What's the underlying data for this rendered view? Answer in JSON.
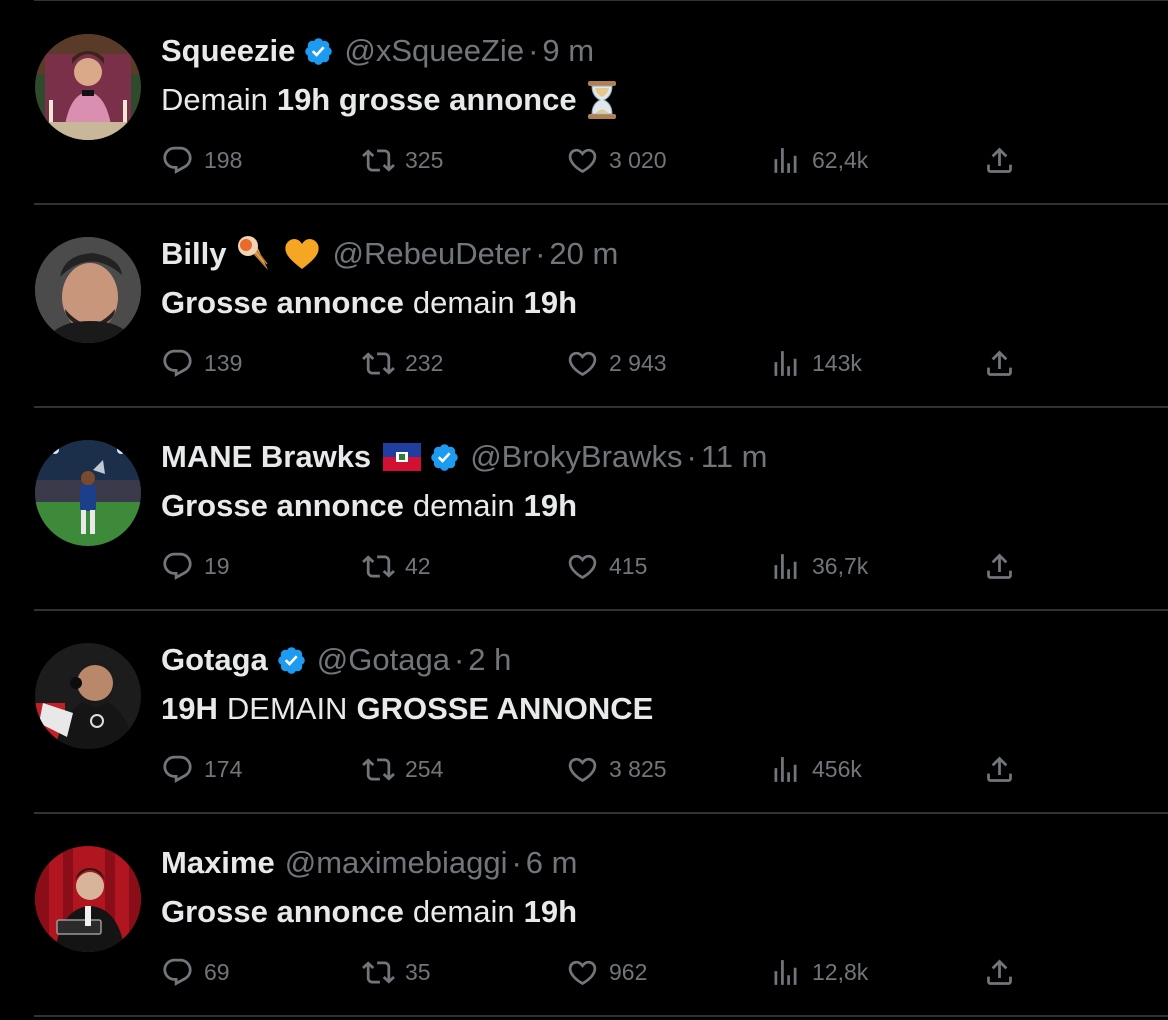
{
  "colors": {
    "background": "#000000",
    "text_primary": "#e7e9ea",
    "text_secondary": "#71767b",
    "divider": "#2f3336",
    "verified_blue": "#1d9bf0"
  },
  "tweets": [
    {
      "name": "Squeezie",
      "verified": true,
      "handle": "@xSqueeZie",
      "separator": "·",
      "time": "9 m",
      "text_parts": [
        "Demain",
        "19h grosse annonce"
      ],
      "emoji": "hourglass-emoji",
      "replies": "198",
      "retweets": "325",
      "likes": "3 020",
      "views": "62,4k"
    },
    {
      "name": "Billy",
      "verified": false,
      "handle": "@RebeuDeter",
      "separator": "·",
      "time": "20 m",
      "text_parts": [
        "Grosse annonce",
        "demain",
        "19h"
      ],
      "name_emojis": [
        "ice-cream-cone-emoji",
        "orange-heart-emoji"
      ],
      "replies": "139",
      "retweets": "232",
      "likes": "2 943",
      "views": "143k"
    },
    {
      "name": "MANE Brawks",
      "verified": true,
      "handle": "@BrokyBrawks",
      "separator": "·",
      "time": "11 m",
      "text_parts": [
        "Grosse annonce",
        "demain",
        "19h"
      ],
      "name_emojis": [
        "haiti-flag-emoji"
      ],
      "replies": "19",
      "retweets": "42",
      "likes": "415",
      "views": "36,7k"
    },
    {
      "name": "Gotaga",
      "verified": true,
      "handle": "@Gotaga",
      "separator": "·",
      "time": "2 h",
      "text_parts": [
        "19H",
        "DEMAIN",
        "GROSSE ANNONCE"
      ],
      "replies": "174",
      "retweets": "254",
      "likes": "3 825",
      "views": "456k"
    },
    {
      "name": "Maxime",
      "verified": false,
      "handle": "@maximebiaggi",
      "separator": "·",
      "time": "6 m",
      "text_parts": [
        "Grosse annonce",
        "demain",
        "19h"
      ],
      "replies": "69",
      "retweets": "35",
      "likes": "962",
      "views": "12,8k"
    }
  ]
}
